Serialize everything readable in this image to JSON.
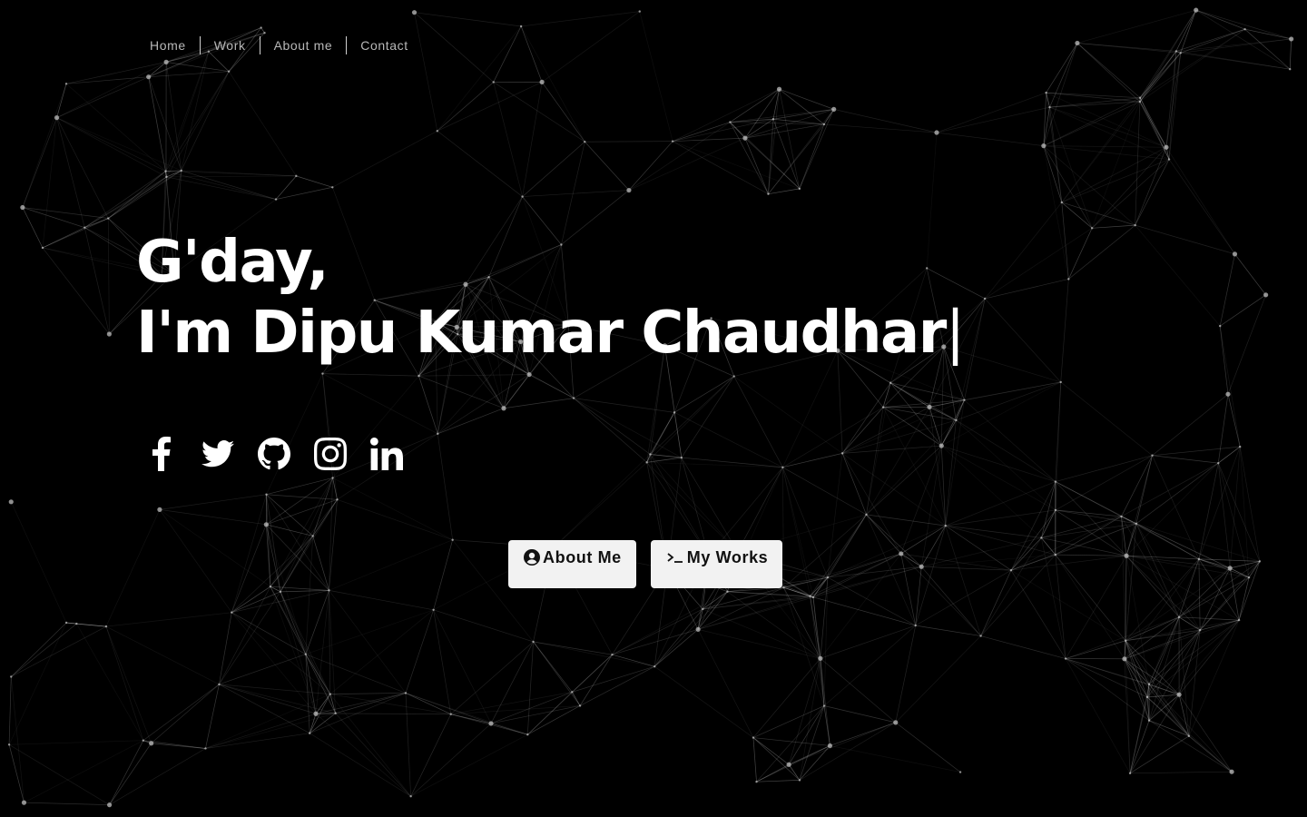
{
  "nav": {
    "items": [
      {
        "label": "Home"
      },
      {
        "label": "Work"
      },
      {
        "label": "About me"
      },
      {
        "label": "Contact"
      }
    ]
  },
  "hero": {
    "greeting": "G'day,",
    "name_line": "I'm Dipu Kumar Chaudhar",
    "cursor": "|"
  },
  "social": {
    "icons": [
      "facebook-icon",
      "twitter-icon",
      "github-icon",
      "instagram-icon",
      "linkedin-icon"
    ]
  },
  "buttons": {
    "about_label": "About Me",
    "works_label": "My Works"
  },
  "colors": {
    "background": "#000000",
    "text": "#ffffff",
    "nav_text": "#b8b8b8",
    "button_bg": "#f2f2f2",
    "button_text": "#111111",
    "network_line": "#ffffff"
  }
}
